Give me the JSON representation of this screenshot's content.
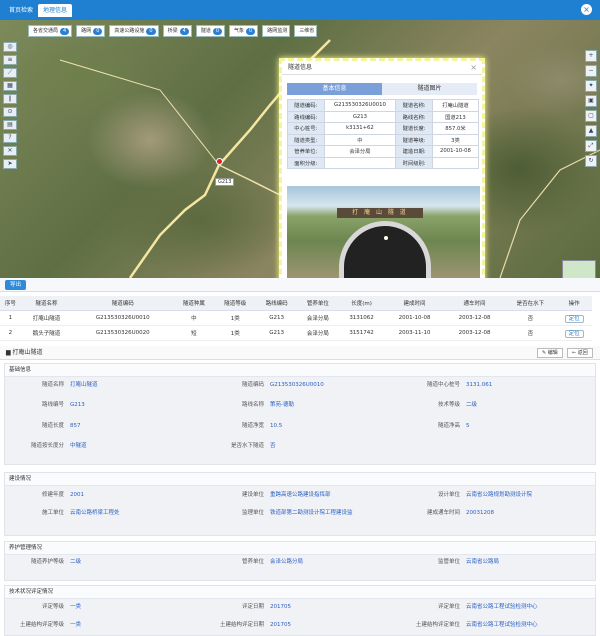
{
  "tabs": [
    {
      "label": "首页检索"
    },
    {
      "label": "地理信息"
    }
  ],
  "layers": [
    {
      "label": "各省交通局",
      "count": "4"
    },
    {
      "label": "路网",
      "count": "0"
    },
    {
      "label": "高速公路设施",
      "count": "0"
    },
    {
      "label": "桥梁",
      "count": "4"
    },
    {
      "label": "隧道",
      "count": "0"
    },
    {
      "label": "气象",
      "count": "0"
    },
    {
      "label": "路网监测",
      "count": ""
    },
    {
      "label": "三维省",
      "count": ""
    }
  ],
  "map": {
    "road_label": "G213"
  },
  "popup": {
    "title": "隧道信息",
    "tabs": [
      "基本信息",
      "隧道图片"
    ],
    "rows": [
      [
        "隧道编码:",
        "G213530326U0010",
        "隧道名称:",
        "打庵山隧道"
      ],
      [
        "路线编码:",
        "G213",
        "路线名称:",
        "国道213"
      ],
      [
        "中心桩号:",
        "k3131+62",
        "隧道长度:",
        "857.0米"
      ],
      [
        "隧道类型:",
        "中",
        "隧道等级:",
        "3类"
      ],
      [
        "管养单位:",
        "会泽分局",
        "建造日期:",
        "2001-10-08"
      ],
      [
        "面积分级:",
        "",
        "时间级别:",
        ""
      ]
    ],
    "photo_sign": "打 庵 山 隧 道"
  },
  "list": {
    "export_label": "导出",
    "headers": [
      "序号",
      "隧道名称",
      "隧道编码",
      "隧道种属",
      "隧道等级",
      "路线编码",
      "管养单位",
      "长度(m)",
      "建成时间",
      "通车时间",
      "是否在水下",
      "操作"
    ],
    "rows": [
      [
        "1",
        "打庵山隧道",
        "G213530326U0010",
        "中",
        "1类",
        "G213",
        "会泽分局",
        "3131062",
        "2001-10-08",
        "2003-12-08",
        "否",
        "定位"
      ],
      [
        "2",
        "鹅头子隧道",
        "G213530326U0020",
        "短",
        "1类",
        "G213",
        "会泽分局",
        "3151742",
        "2003-11-10",
        "2003-12-08",
        "否",
        "定位"
      ]
    ]
  },
  "detail": {
    "title": "打庵山隧道",
    "edit_label": "编辑",
    "back_label": "返回",
    "sections": [
      {
        "title": "基础信息",
        "fields": [
          [
            "隧道名称",
            "打庵山隧道",
            "隧道编码",
            "G213530326U0010",
            "隧道中心桩号",
            "3131.061"
          ],
          [
            "路线编号",
            "G213",
            "路线名称",
            "策苑-德勒",
            "技术等级",
            "二级"
          ],
          [
            "隧道长度",
            "857",
            "隧道净宽",
            "10.5",
            "隧道净高",
            "5"
          ],
          [
            "隧道按长度分",
            "中隧道",
            "是否水下隧道",
            "否",
            "",
            ""
          ]
        ]
      },
      {
        "title": "建设情况",
        "fields": [
          [
            "修建年度",
            "2001",
            "建设单位",
            "重跨高速公路建设指挥部",
            "设计单位",
            "云南省公路规划勘测设计院"
          ],
          [
            "施工单位",
            "云南公路桥梁工程处",
            "监理单位",
            "铁道部第二勘测设计院工程建设监",
            "建成通车时间",
            "20031208"
          ]
        ]
      },
      {
        "title": "养护管理情况",
        "fields": [
          [
            "隧道养护等级",
            "二级",
            "管养单位",
            "会泽公路分局",
            "监管单位",
            "云南省公路局"
          ]
        ]
      },
      {
        "title": "技术状况评定情况",
        "fields": [
          [
            "评定等级",
            "一类",
            "评定日期",
            "201705",
            "评定单位",
            "云南省公路工程试验检测中心"
          ],
          [
            "土建结构评定等级",
            "一类",
            "土建结构评定日期",
            "201705",
            "土建结构评定单位",
            "云南省公路工程试验检测中心"
          ]
        ]
      }
    ]
  }
}
